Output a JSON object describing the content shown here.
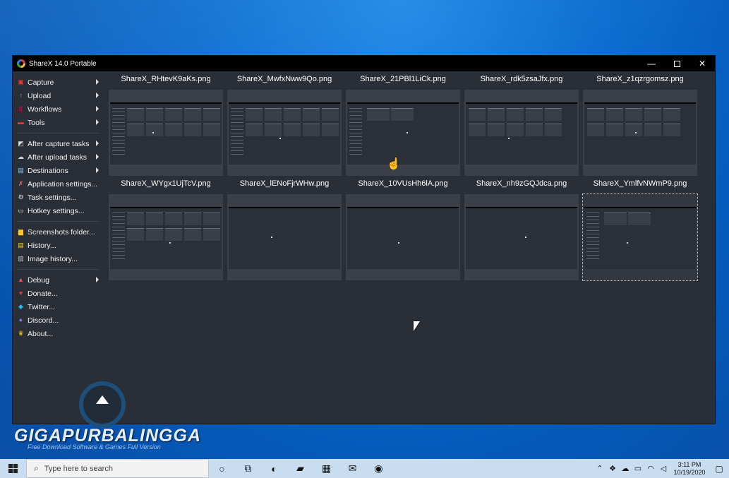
{
  "window": {
    "title": "ShareX 14.0 Portable",
    "minimize_glyph": "—",
    "maximize_glyph": "",
    "close_glyph": "✕"
  },
  "sidebar": {
    "groups": [
      [
        {
          "label": "Capture",
          "icon": "camera-icon",
          "glyph": "▣",
          "color": "#e53935",
          "submenu": true
        },
        {
          "label": "Upload",
          "icon": "upload-arrow-icon",
          "glyph": "↑",
          "color": "#42a5f5",
          "submenu": true
        },
        {
          "label": "Workflows",
          "icon": "grid-dots-icon",
          "glyph": "⁞⁞",
          "color": "#e91e63",
          "submenu": true
        },
        {
          "label": "Tools",
          "icon": "toolbox-icon",
          "glyph": "▬",
          "color": "#e53935",
          "submenu": true
        }
      ],
      [
        {
          "label": "After capture tasks",
          "icon": "capture-tasks-icon",
          "glyph": "◩",
          "color": "#cfd8dc",
          "submenu": true
        },
        {
          "label": "After upload tasks",
          "icon": "cloud-upload-icon",
          "glyph": "☁",
          "color": "#cfd8dc",
          "submenu": true
        },
        {
          "label": "Destinations",
          "icon": "destinations-icon",
          "glyph": "▤",
          "color": "#90caf9",
          "submenu": true
        },
        {
          "label": "Application settings...",
          "icon": "wrench-icon",
          "glyph": "✗",
          "color": "#e57373",
          "submenu": false
        },
        {
          "label": "Task settings...",
          "icon": "gear-icon",
          "glyph": "⚙",
          "color": "#cfd8dc",
          "submenu": false
        },
        {
          "label": "Hotkey settings...",
          "icon": "keyboard-icon",
          "glyph": "▭",
          "color": "#eeeeee",
          "submenu": false
        }
      ],
      [
        {
          "label": "Screenshots folder...",
          "icon": "folder-icon",
          "glyph": "▆",
          "color": "#ffca28",
          "submenu": false
        },
        {
          "label": "History...",
          "icon": "history-icon",
          "glyph": "▤",
          "color": "#ffd54f",
          "submenu": false
        },
        {
          "label": "Image history...",
          "icon": "image-history-icon",
          "glyph": "▨",
          "color": "#b0bec5",
          "submenu": false
        }
      ],
      [
        {
          "label": "Debug",
          "icon": "debug-flask-icon",
          "glyph": "▲",
          "color": "#ef5350",
          "submenu": true
        },
        {
          "label": "Donate...",
          "icon": "heart-icon",
          "glyph": "♥",
          "color": "#e53935",
          "submenu": false
        },
        {
          "label": "Twitter...",
          "icon": "twitter-bird-icon",
          "glyph": "◆",
          "color": "#29b6f6",
          "submenu": false
        },
        {
          "label": "Discord...",
          "icon": "discord-icon",
          "glyph": "●",
          "color": "#7986cb",
          "submenu": false
        },
        {
          "label": "About...",
          "icon": "crown-icon",
          "glyph": "♛",
          "color": "#ffca28",
          "submenu": false
        }
      ]
    ]
  },
  "thumbnails": [
    {
      "filename": "ShareX_RHtevK9aKs.png",
      "style": "cells"
    },
    {
      "filename": "ShareX_MwfxNww9Qo.png",
      "style": "cells"
    },
    {
      "filename": "ShareX_21PBl1LiCk.png",
      "style": "table"
    },
    {
      "filename": "ShareX_rdk5zsaJfx.png",
      "style": "cells-light"
    },
    {
      "filename": "ShareX_z1qzrgomsz.png",
      "style": "cells-light"
    },
    {
      "filename": "ShareX_WYgx1UjTcV.png",
      "style": "cells"
    },
    {
      "filename": "ShareX_lENoFjrWHw.png",
      "style": "plain"
    },
    {
      "filename": "ShareX_10VUsHh6lA.png",
      "style": "plain"
    },
    {
      "filename": "ShareX_nh9zGQJdca.png",
      "style": "plain-light"
    },
    {
      "filename": "ShareX_YmlfvNWmP9.png",
      "style": "table",
      "selected": true
    }
  ],
  "watermark": {
    "name": "GIGAPURBALINGGA",
    "tagline": "Free Download Software & Games Full Version"
  },
  "taskbar": {
    "search_placeholder": "Type here to search",
    "time": "3:11 PM",
    "date": "10/19/2020",
    "apps": [
      {
        "icon": "cortana-circle-icon",
        "glyph": "○"
      },
      {
        "icon": "task-view-icon",
        "glyph": "⧉"
      },
      {
        "icon": "edge-browser-icon",
        "glyph": "◐"
      },
      {
        "icon": "file-explorer-icon",
        "glyph": "▰"
      },
      {
        "icon": "store-bag-icon",
        "glyph": "▦"
      },
      {
        "icon": "mail-icon",
        "glyph": "✉"
      },
      {
        "icon": "chrome-icon",
        "glyph": "◉"
      }
    ],
    "tray": [
      {
        "icon": "chevron-up-icon",
        "glyph": "⌃"
      },
      {
        "icon": "dropbox-icon",
        "glyph": "❖"
      },
      {
        "icon": "onedrive-cloud-icon",
        "glyph": "☁"
      },
      {
        "icon": "battery-icon",
        "glyph": "▭"
      },
      {
        "icon": "wifi-icon",
        "glyph": "◠"
      },
      {
        "icon": "volume-icon",
        "glyph": "◁"
      }
    ]
  }
}
